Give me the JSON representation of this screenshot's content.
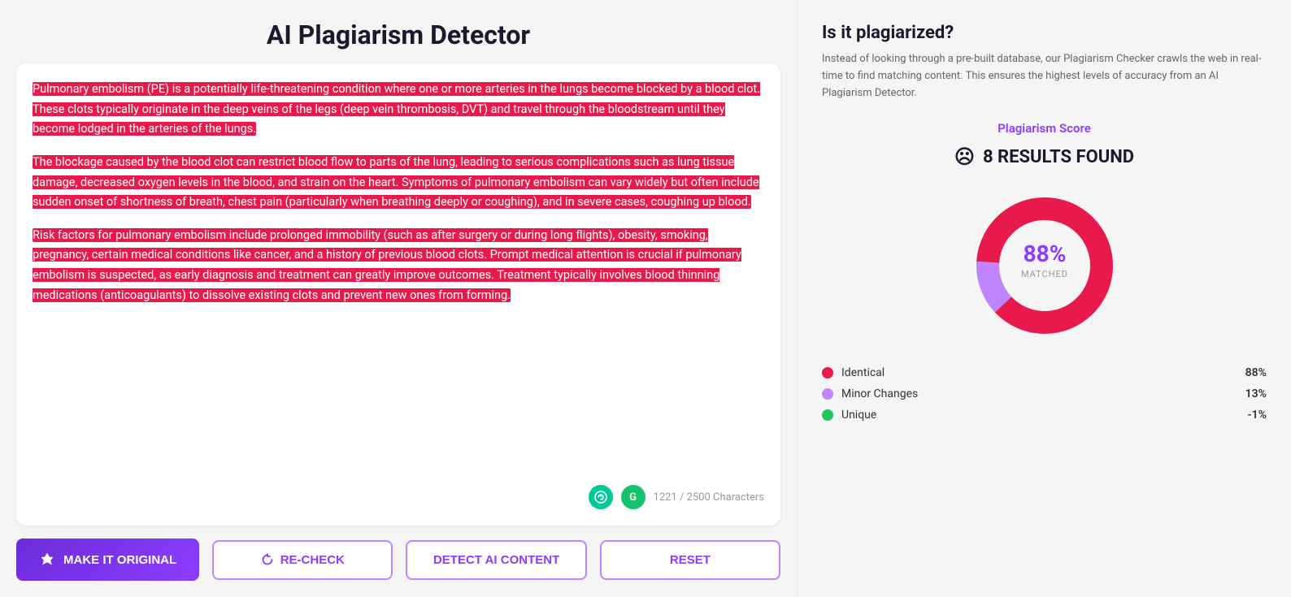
{
  "header": {
    "title": "AI Plagiarism Detector"
  },
  "textarea": {
    "paragraphs": [
      "Pulmonary embolism (PE) is a potentially life-threatening condition where one or more arteries in the lungs become blocked by a blood clot. These clots typically originate in the deep veins of the legs (deep vein thrombosis, DVT) and travel through the bloodstream until they become lodged in the arteries of the lungs.",
      "The blockage caused by the blood clot can restrict blood flow to parts of the lung, leading to serious complications such as lung tissue damage, decreased oxygen levels in the blood, and strain on the heart. Symptoms of pulmonary embolism can vary widely but often include sudden onset of shortness of breath, chest pain (particularly when breathing deeply or coughing), and in severe cases, coughing up blood.",
      "Risk factors for pulmonary embolism include prolonged immobility (such as after surgery or during long flights), obesity, smoking, pregnancy, certain medical conditions like cancer, and a history of previous blood clots. Prompt medical attention is crucial if pulmonary embolism is suspected, as early diagnosis and treatment can greatly improve outcomes. Treatment typically involves blood thinning medications (anticoagulants) to dissolve existing clots and prevent new ones from forming."
    ],
    "char_count": "1221 / 2500 Characters"
  },
  "buttons": {
    "make_original": "MAKE IT ORIGINAL",
    "recheck": "RE-CHECK",
    "detect_ai": "DETECT AI CONTENT",
    "reset": "RESET"
  },
  "right_panel": {
    "question": "Is it plagiarized?",
    "description": "Instead of looking through a pre-built database, our Plagiarism Checker crawls the web in real-time to find matching content. This ensures the highest levels of accuracy from an AI Plagiarism Detector.",
    "score_label": "Plagiarism Score",
    "results_found": "8 RESULTS FOUND",
    "percentage": "88%",
    "matched_label": "MATCHED",
    "legend": [
      {
        "label": "Identical",
        "pct": "88%",
        "color": "#e8194b"
      },
      {
        "label": "Minor Changes",
        "pct": "13%",
        "color": "#c084fc"
      },
      {
        "label": "Unique",
        "pct": "-1%",
        "color": "#22c55e"
      }
    ],
    "donut": {
      "identical_pct": 88,
      "minor_pct": 13,
      "unique_pct": -1
    }
  }
}
